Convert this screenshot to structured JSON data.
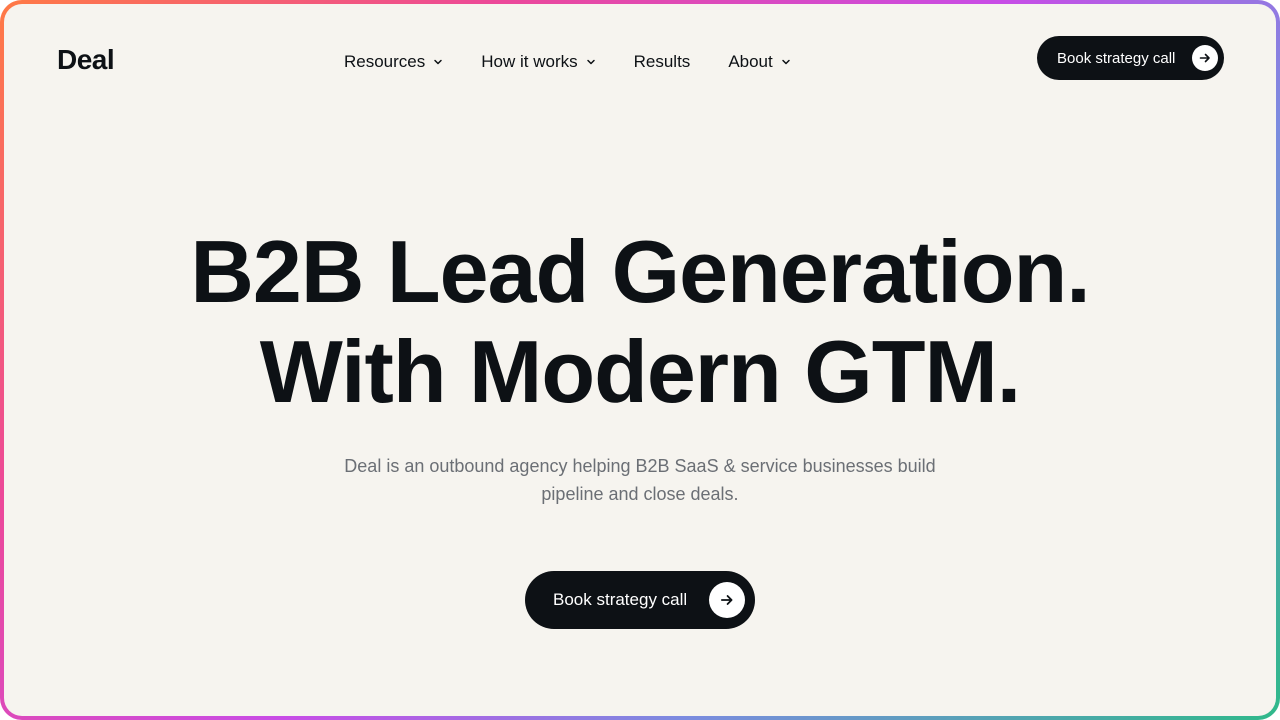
{
  "brand": {
    "logo_text": "Deal"
  },
  "nav": {
    "items": [
      {
        "label": "Resources",
        "has_dropdown": true
      },
      {
        "label": "How it works",
        "has_dropdown": true
      },
      {
        "label": "Results",
        "has_dropdown": false
      },
      {
        "label": "About",
        "has_dropdown": true
      }
    ]
  },
  "header": {
    "cta_label": "Book strategy call",
    "cta_icon": "arrow-right-icon"
  },
  "hero": {
    "title_line_1": "B2B Lead Generation.",
    "title_line_2": "With Modern GTM.",
    "subtitle": "Deal is an outbound agency helping B2B SaaS & service businesses build pipeline and close deals.",
    "cta_label": "Book strategy call",
    "cta_icon": "arrow-right-icon"
  },
  "colors": {
    "background": "#f6f4ef",
    "text": "#0d1115",
    "muted_text": "#6b6f75",
    "button": "#0d1115",
    "border_gradient": [
      "#ff7a45",
      "#ec4899",
      "#c84ce6",
      "#7c8be0",
      "#2fb98a"
    ]
  }
}
